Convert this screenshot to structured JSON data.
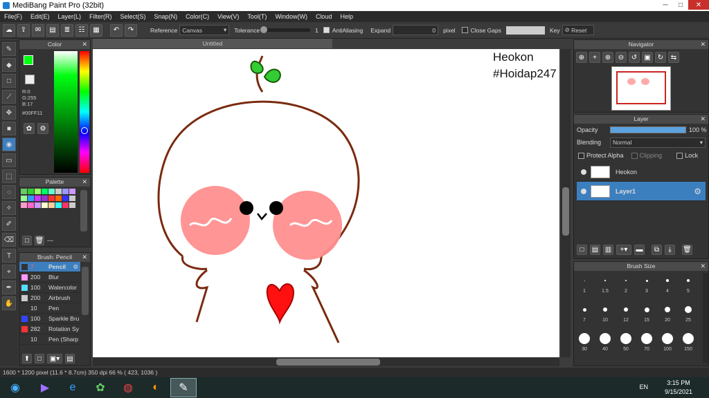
{
  "window": {
    "title": "MediBang Paint Pro (32bit)"
  },
  "menu": [
    "File(F)",
    "Edit(E)",
    "Layer(L)",
    "Filter(R)",
    "Select(S)",
    "Snap(N)",
    "Color(C)",
    "View(V)",
    "Tool(T)",
    "Window(W)",
    "Cloud",
    "Help"
  ],
  "toolbar": {
    "reference_label": "Reference",
    "reference_value": "Canvas",
    "tolerance_label": "Tolerance",
    "tolerance_value": "1",
    "antialias_label": "AntiAliasing",
    "expand_label": "Expand",
    "expand_value": "0",
    "expand_unit": "pixel",
    "close_gaps_label": "Close Gaps",
    "key_label": "Key",
    "reset_label": "Reset"
  },
  "color_panel": {
    "title": "Color",
    "r": "R:0",
    "g": "G:255",
    "b": "B:17",
    "hex": "#00FF11"
  },
  "palette_panel": {
    "title": "Palette",
    "footer": "---"
  },
  "brush_panel": {
    "title": "Brush: Pencil",
    "items": [
      {
        "size": "7",
        "name": "Pencil",
        "color": "#333333",
        "active": true
      },
      {
        "size": "200",
        "name": "Blur",
        "color": "#ff99ff"
      },
      {
        "size": "100",
        "name": "Watercolor",
        "color": "#55ddff"
      },
      {
        "size": "200",
        "name": "Airbrush",
        "color": "#cccccc"
      },
      {
        "size": "10",
        "name": "Pen",
        "color": "#333333"
      },
      {
        "size": "100",
        "name": "Sparkle Bru",
        "color": "#3344ff"
      },
      {
        "size": "282",
        "name": "Rotation Sy",
        "color": "#ff3333"
      },
      {
        "size": "10",
        "name": "Pen (Sharp",
        "color": "#333333"
      }
    ]
  },
  "document": {
    "tab": "Untitled",
    "text_line1": "Heokon",
    "text_line2": "#Hoidap247"
  },
  "navigator": {
    "title": "Navigator"
  },
  "layer_panel": {
    "title": "Layer",
    "opacity_label": "Opacity",
    "opacity_value": "100 %",
    "blending_label": "Blending",
    "blending_value": "Normal",
    "protect_alpha": "Protect Alpha",
    "clipping": "Clipping",
    "lock": "Lock",
    "layers": [
      {
        "name": "Heokon",
        "active": false
      },
      {
        "name": "Layer1",
        "active": true
      }
    ]
  },
  "brush_size_panel": {
    "title": "Brush Size",
    "sizes": [
      "1",
      "1.5",
      "2",
      "3",
      "4",
      "5",
      "7",
      "10",
      "12",
      "15",
      "20",
      "25",
      "30",
      "40",
      "50",
      "70",
      "100",
      "150"
    ]
  },
  "status": {
    "text": "1600 * 1200 pixel   (11.6 * 8.7cm)  350 dpi  66 %   ( 423, 1036 )"
  },
  "taskbar": {
    "lang": "EN",
    "time": "3:15 PM",
    "date": "9/15/2021"
  },
  "colors": {
    "accent": "#3c7fbf",
    "primary_color": "#00FF11",
    "secondary_color": "#ff6600"
  }
}
